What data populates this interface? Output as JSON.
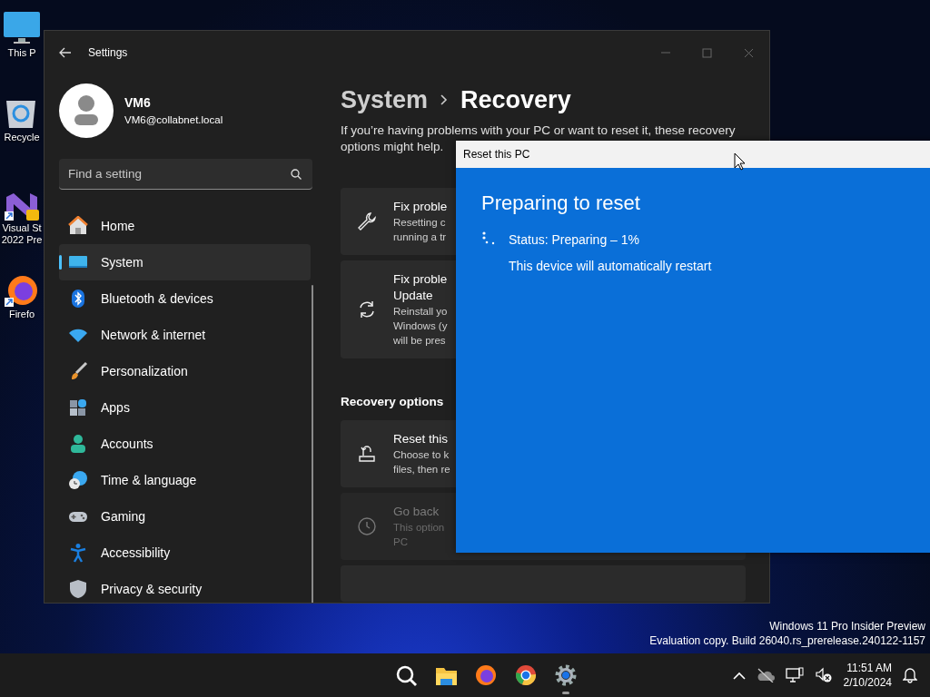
{
  "desktop_icons": [
    {
      "lines": [
        "This P"
      ]
    },
    {
      "lines": [
        "Recycle"
      ]
    },
    {
      "lines": [
        "Visual St",
        "2022 Pre"
      ]
    },
    {
      "lines": [
        "Firefo"
      ]
    }
  ],
  "settings": {
    "title": "Settings",
    "user": {
      "name": "VM6",
      "email": "VM6@collabnet.local"
    },
    "search": {
      "placeholder": "Find a setting"
    },
    "nav": [
      {
        "label": "Home",
        "selected": false
      },
      {
        "label": "System",
        "selected": true
      },
      {
        "label": "Bluetooth & devices",
        "selected": false
      },
      {
        "label": "Network & internet",
        "selected": false
      },
      {
        "label": "Personalization",
        "selected": false
      },
      {
        "label": "Apps",
        "selected": false
      },
      {
        "label": "Accounts",
        "selected": false
      },
      {
        "label": "Time & language",
        "selected": false
      },
      {
        "label": "Gaming",
        "selected": false
      },
      {
        "label": "Accessibility",
        "selected": false
      },
      {
        "label": "Privacy & security",
        "selected": false
      }
    ],
    "breadcrumb": [
      "System",
      "Recovery"
    ],
    "description": [
      "If you’re having problems with your PC or want to reset it, these recovery",
      "options might help."
    ],
    "cards_top": [
      {
        "title_lines": [
          "Fix proble"
        ],
        "lines": [
          "Resetting c",
          "running a tr"
        ],
        "disabled": false
      },
      {
        "title_lines": [
          "Fix proble",
          "Update"
        ],
        "lines": [
          "Reinstall yo",
          "Windows (y",
          "will be pres"
        ],
        "disabled": false
      }
    ],
    "section_heading": "Recovery options",
    "cards_bottom": [
      {
        "title_lines": [
          "Reset this"
        ],
        "lines": [
          "Choose to k",
          "files, then re"
        ],
        "disabled": false
      },
      {
        "title_lines": [
          "Go back"
        ],
        "lines": [
          "This option",
          "PC"
        ],
        "disabled": true
      }
    ]
  },
  "reset_dialog": {
    "title": "Reset this PC",
    "heading": "Preparing to reset",
    "status": "Status: Preparing – 1%",
    "note": "This device will automatically restart"
  },
  "watermark": [
    "Windows 11 Pro Insider Preview",
    "Evaluation copy. Build 26040.rs_prerelease.240122-1157"
  ],
  "taskbar": {
    "apps": [
      {
        "active": false
      },
      {
        "active": false
      },
      {
        "active": false
      },
      {
        "active": false
      },
      {
        "active": true
      }
    ],
    "time": "11:51 AM",
    "date": "2/10/2024"
  }
}
